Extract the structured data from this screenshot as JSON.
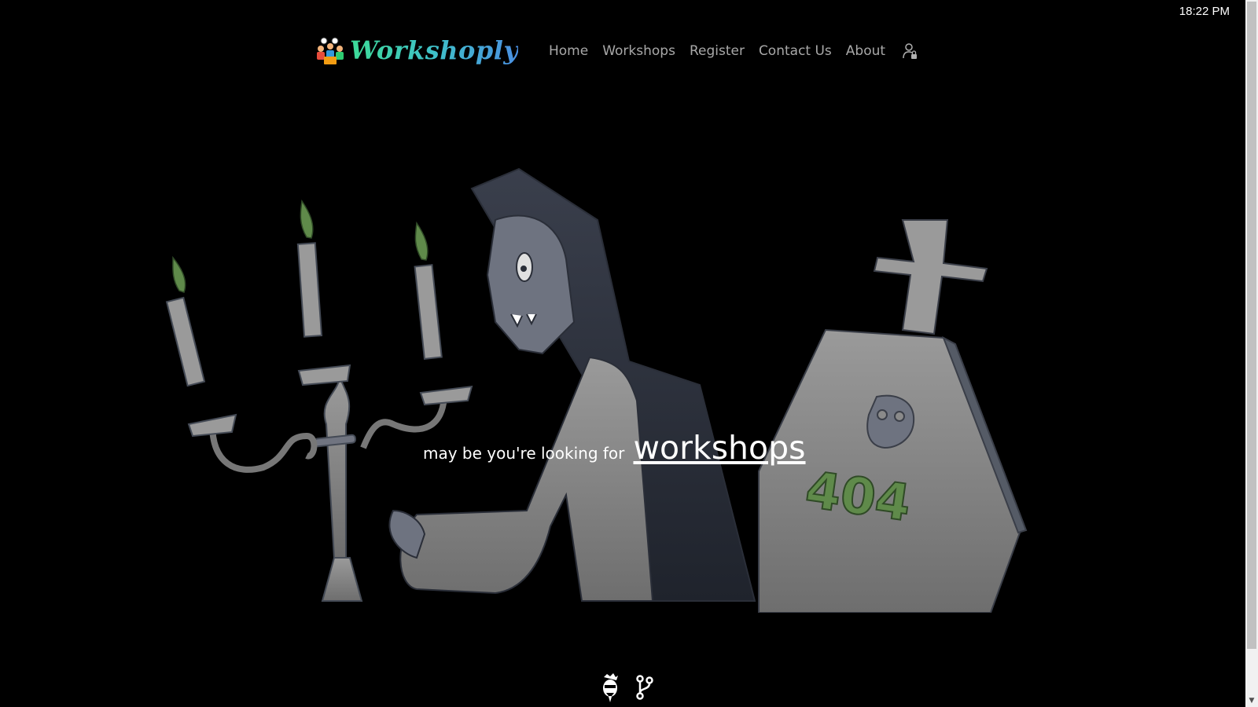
{
  "system": {
    "clock": "18:22 PM"
  },
  "brand": {
    "name": "Workshoply"
  },
  "nav": {
    "items": [
      {
        "label": "Home"
      },
      {
        "label": "Workshops"
      },
      {
        "label": "Register"
      },
      {
        "label": "Contact Us"
      },
      {
        "label": "About"
      }
    ],
    "user_icon": "user-lock-icon"
  },
  "hero": {
    "message_lead": "may be you're looking for",
    "message_link": "workshops",
    "tombstone_text": "404",
    "illustration": "vampire-candelabra-tombstone-illustration"
  },
  "footer": {
    "icons": [
      "developer-avatar-icon",
      "git-branch-icon"
    ]
  },
  "colors": {
    "background": "#000000",
    "nav_text": "#a8a8a8",
    "brand_gradient_start": "#3ddc97",
    "brand_gradient_end": "#4a90e2",
    "flame": "#5f8a4a",
    "stone": "#8a8a8a"
  }
}
